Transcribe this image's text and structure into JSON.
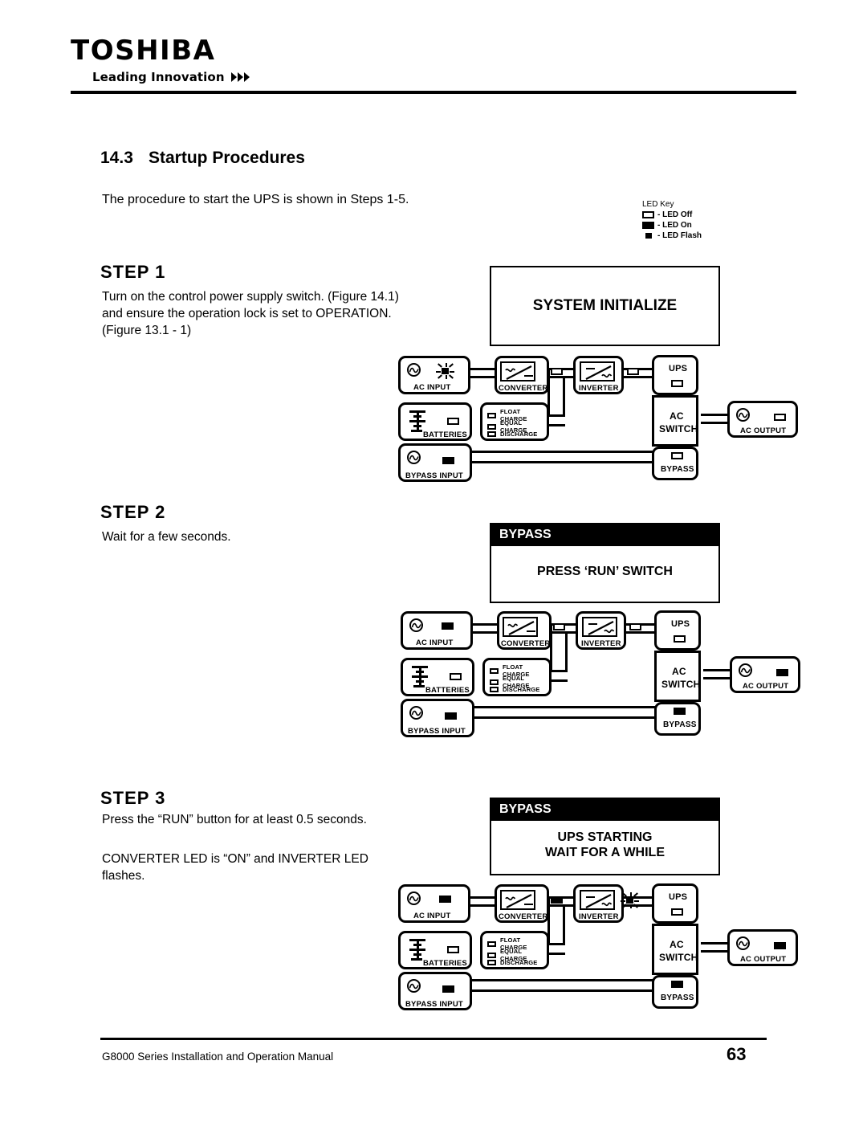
{
  "header": {
    "brand": "TOSHIBA",
    "tagline": "Leading Innovation",
    "chevron_icon": "chevrons-right-icon"
  },
  "section": {
    "number": "14.3",
    "title": "Startup Procedures",
    "intro": "The procedure to start the UPS is shown in Steps 1-5."
  },
  "led_key": {
    "title": "LED Key",
    "items": [
      {
        "state": "off",
        "label": "- LED Off"
      },
      {
        "state": "on",
        "label": "- LED On"
      },
      {
        "state": "flash",
        "label": "- LED Flash"
      }
    ]
  },
  "steps": [
    {
      "heading": "STEP  1",
      "body": "Turn on the control power supply switch. (Figure 14.1) and ensure the operation lock is set to OPERATION. (Figure 13.1 - 1)",
      "lcd": {
        "style": "plain",
        "bar": "",
        "lines": [
          "SYSTEM INITIALIZE"
        ]
      },
      "leds": {
        "ac_input": "flash",
        "converter": "off",
        "inverter": "off",
        "ups": "off",
        "batteries": "off",
        "float_charge": "off",
        "equal_charge": "off",
        "discharge": "off",
        "bypass_input": "on",
        "bypass": "off",
        "ac_output": "off"
      }
    },
    {
      "heading": "STEP  2",
      "body": "Wait for a few seconds.",
      "lcd": {
        "style": "bar",
        "bar": "BYPASS",
        "lines": [
          "PRESS ‘RUN’ SWITCH"
        ]
      },
      "leds": {
        "ac_input": "on",
        "converter": "off",
        "inverter": "off",
        "ups": "off",
        "batteries": "off",
        "float_charge": "off",
        "equal_charge": "off",
        "discharge": "off",
        "bypass_input": "on",
        "bypass": "on",
        "ac_output": "on"
      }
    },
    {
      "heading": "STEP  3",
      "body": "Press the “RUN” button for at least 0.5 seconds.",
      "body2": "CONVERTER LED is “ON” and INVERTER LED flashes.",
      "lcd": {
        "style": "bar",
        "bar": "BYPASS",
        "lines": [
          "UPS STARTING",
          "WAIT FOR A WHILE"
        ]
      },
      "leds": {
        "ac_input": "on",
        "converter": "on",
        "inverter": "flash",
        "ups": "off",
        "batteries": "off",
        "float_charge": "off",
        "equal_charge": "off",
        "discharge": "off",
        "bypass_input": "on",
        "bypass": "on",
        "ac_output": "on"
      }
    }
  ],
  "diagram_labels": {
    "ac_input": "AC INPUT",
    "converter": "CONVERTER",
    "inverter": "INVERTER",
    "ups": "UPS",
    "batteries": "BATTERIES",
    "float_charge": "FLOAT CHARGE",
    "equal_charge": "EQUAL CHARGE",
    "discharge": "DISCHARGE",
    "bypass_input": "BYPASS INPUT",
    "ac_switch_1": "AC",
    "ac_switch_2": "SWITCH",
    "ac_output": "AC OUTPUT",
    "bypass": "BYPASS"
  },
  "footer": {
    "text": "G8000 Series Installation and Operation Manual",
    "page": "63"
  }
}
